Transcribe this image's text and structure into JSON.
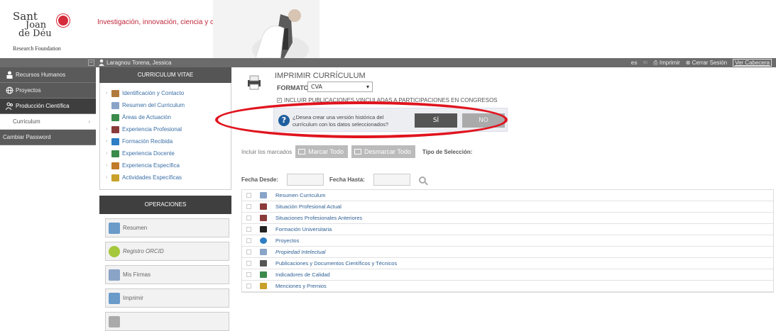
{
  "header": {
    "logo": {
      "line1": "Sant",
      "line2": "Joan",
      "line3": "de Déu",
      "line4": "Research Foundation"
    },
    "tagline": "Investigación, innovación, ciencia y compromiso"
  },
  "topbar": {
    "user_name": "Laragnou Torena, Jessica",
    "lang": "es",
    "print_label": "Imprimir",
    "logout_label": "Cerrar Sesión",
    "header_toggle_label": "Ver Cabecera"
  },
  "leftnav": {
    "items": [
      {
        "label": "Recursos Humanos",
        "icon": "person-icon"
      },
      {
        "label": "Proyectos",
        "icon": "globe-icon"
      },
      {
        "label": "Producción Científica",
        "icon": "people-icon"
      },
      {
        "label": "Curriculum"
      },
      {
        "label": "Cambiar Password"
      }
    ]
  },
  "cv": {
    "title": "CURRICULUM VITAE",
    "items": [
      {
        "label": "Identificación y Contacto",
        "color": "#b07a3c"
      },
      {
        "label": "Resumen del Curriculum",
        "color": "#8aa4c8"
      },
      {
        "label": "Áreas de Actuación",
        "color": "#3a8a4a"
      },
      {
        "label": "Experiencia Profesional",
        "color": "#8b3a3a"
      },
      {
        "label": "Formación Recibida",
        "color": "#2d7ec4"
      },
      {
        "label": "Experiencia Docente",
        "color": "#3a8a4a"
      },
      {
        "label": "Experiencia Específica",
        "color": "#c07a2a"
      },
      {
        "label": "Actividades Específicas",
        "color": "#c9a12a"
      }
    ],
    "ops_title": "OPERACIONES",
    "ops": [
      {
        "label": "Resumen",
        "color": "#6a9bc9"
      },
      {
        "label": "Registro ORCID",
        "color": "#a5c83a"
      },
      {
        "label": "Mis Firmas",
        "color": "#8aa4c8"
      },
      {
        "label": "Imprimir",
        "color": "#6a9bc9"
      },
      {
        "label": "",
        "color": "#aaa"
      }
    ]
  },
  "main": {
    "title": "IMPRIMIR CURRÍCULUM",
    "formato_label": "FORMATO:",
    "formato_value": "CVA",
    "include_label": "INCLUIR PUBLICACIONES VINCULADAS A PARTICIPACIONES EN CONGRESOS",
    "confirm_text": "¿Desea crear una versión histórica del currículum con los datos seleccionados?",
    "yes_label": "SÍ",
    "no_label": "NO",
    "include_marked_label": "Incluir los marcados",
    "mark_all_label": "Marcar Todo",
    "unmark_all_label": "Desmarcar Todo",
    "selection_type_label": "Tipo de Selección:",
    "date_from_label": "Fecha Desde:",
    "date_to_label": "Fecha Hasta:",
    "rows": [
      {
        "label": "Resumen Curriculum",
        "color": "#8aa4c8"
      },
      {
        "label": "Situación Profesional Actual",
        "color": "#8b3a3a"
      },
      {
        "label": "Situaciones Profesionales Anteriores",
        "color": "#8b3a3a"
      },
      {
        "label": "Formación Universitaria",
        "color": "#222"
      },
      {
        "label": "Proyectos",
        "color": "#2d7ec4"
      },
      {
        "label": "Propiedad Intelectual",
        "color": "#8aa4c8",
        "italic": true
      },
      {
        "label": "Publicaciones y Documentos Científicos y Técnicos",
        "color": "#555"
      },
      {
        "label": "Indicadores de Calidad",
        "color": "#3a8a4a"
      },
      {
        "label": "Menciones y Premios",
        "color": "#c9a12a"
      }
    ]
  }
}
